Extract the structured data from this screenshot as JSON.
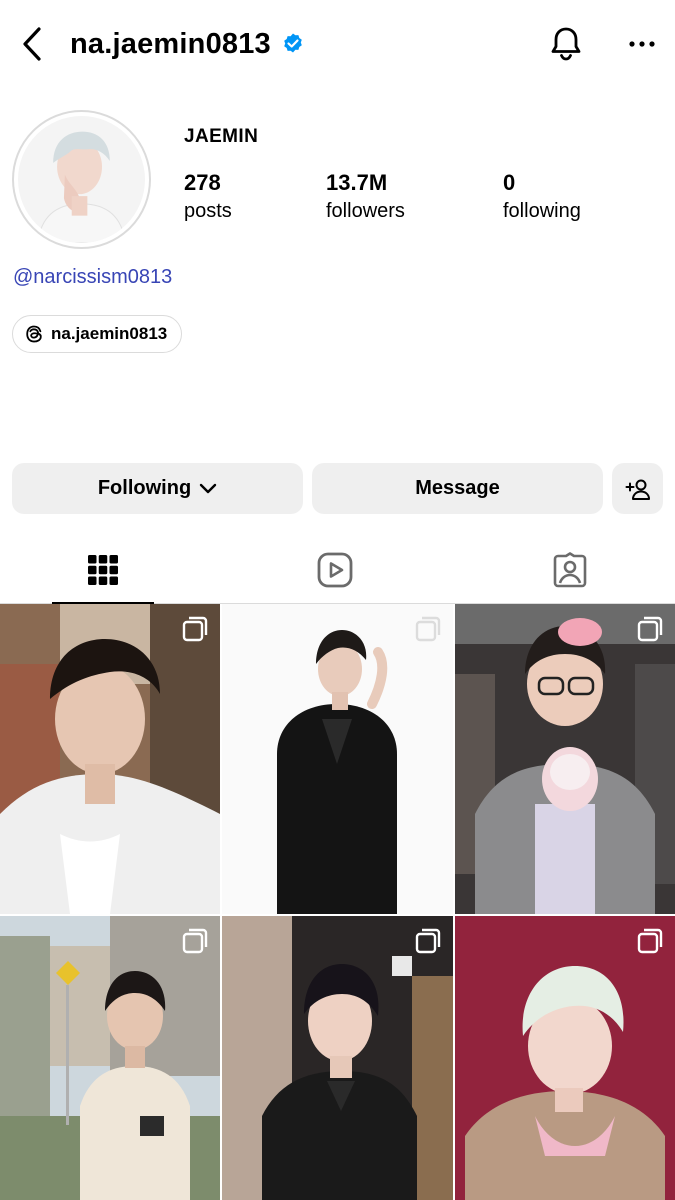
{
  "header": {
    "username": "na.jaemin0813",
    "verified": true,
    "icons": {
      "back": "chevron-left-icon",
      "bell": "bell-icon",
      "more": "more-horizontal-icon",
      "verified": "verified-badge-icon"
    }
  },
  "profile": {
    "display_name": "JAEMIN",
    "stats": [
      {
        "value": "278",
        "label": "posts"
      },
      {
        "value": "13.7M",
        "label": "followers"
      },
      {
        "value": "0",
        "label": "following"
      }
    ],
    "bio_link": "@narcissism0813",
    "threads": {
      "icon": "threads-icon",
      "label": "na.jaemin0813"
    }
  },
  "actions": {
    "following_label": "Following",
    "message_label": "Message",
    "add_user_icon": "add-person-icon"
  },
  "tabs": [
    {
      "icon": "grid-icon",
      "active": true
    },
    {
      "icon": "reels-icon",
      "active": false
    },
    {
      "icon": "tagged-icon",
      "active": false
    }
  ],
  "colors": {
    "link": "#3845b5",
    "verified": "#0095f6",
    "button_bg": "#efefef",
    "divider": "#dbdbdb"
  },
  "posts": [
    {
      "type": "carousel"
    },
    {
      "type": "carousel"
    },
    {
      "type": "carousel"
    },
    {
      "type": "carousel"
    },
    {
      "type": "carousel"
    },
    {
      "type": "carousel"
    }
  ]
}
